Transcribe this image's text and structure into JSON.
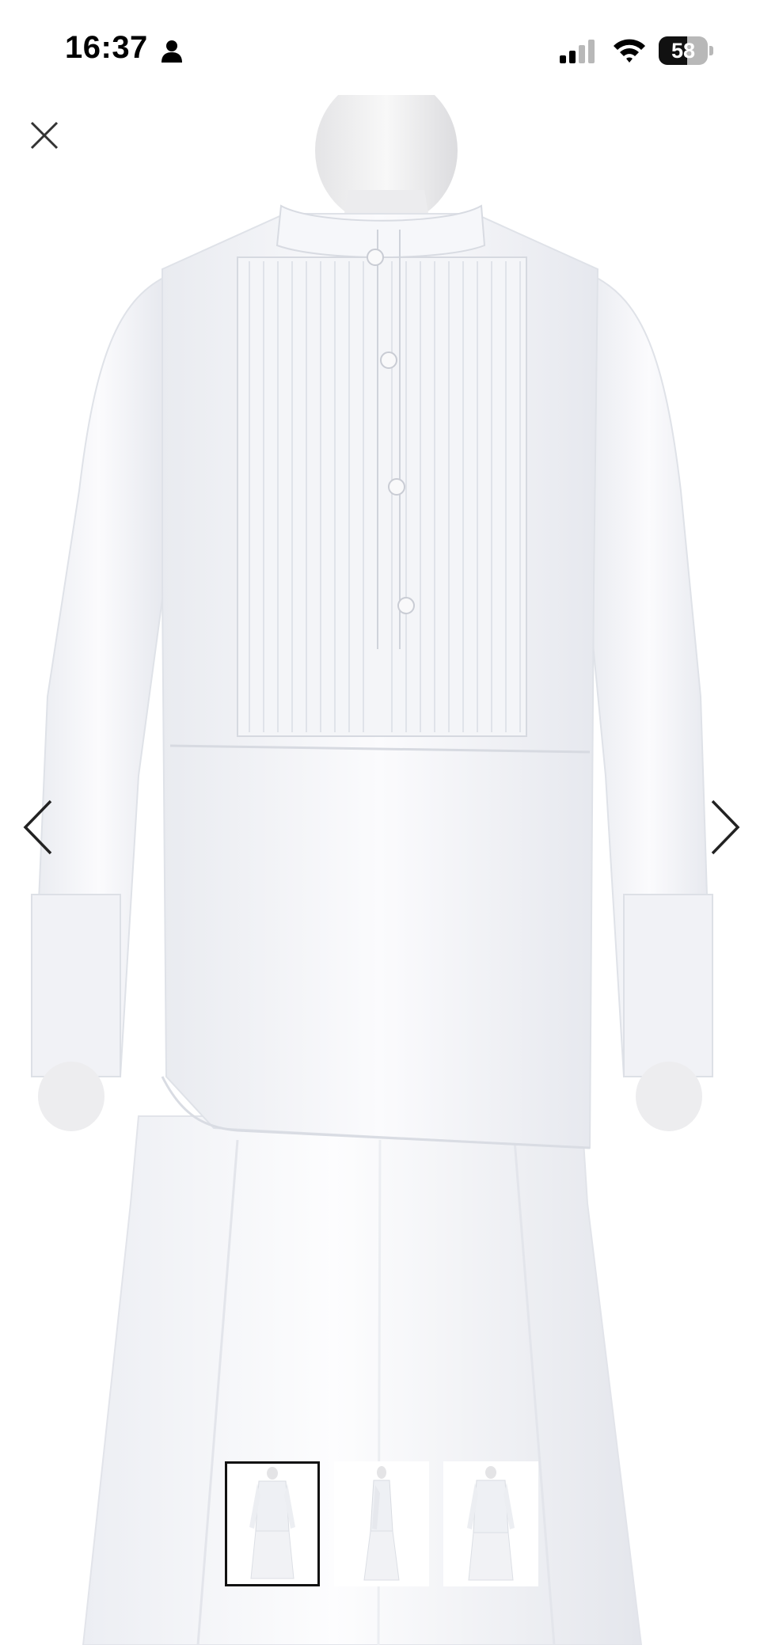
{
  "status_bar": {
    "time": "16:37",
    "battery_level": "58",
    "battery_fraction": 0.58,
    "icons": [
      "person-icon",
      "signal-icon",
      "wifi-icon",
      "battery-icon"
    ]
  },
  "viewer": {
    "close_icon": "close-icon",
    "prev_icon": "chevron-left-icon",
    "next_icon": "chevron-right-icon",
    "photo": "product-photo-white-shirt-and-skirt-on-mannequin"
  },
  "thumbnails": [
    {
      "view": "front",
      "selected": true
    },
    {
      "view": "side",
      "selected": false
    },
    {
      "view": "back",
      "selected": false
    }
  ],
  "colors": {
    "background": "#ffffff",
    "icon": "#222222",
    "thumb_border": "#111111"
  }
}
